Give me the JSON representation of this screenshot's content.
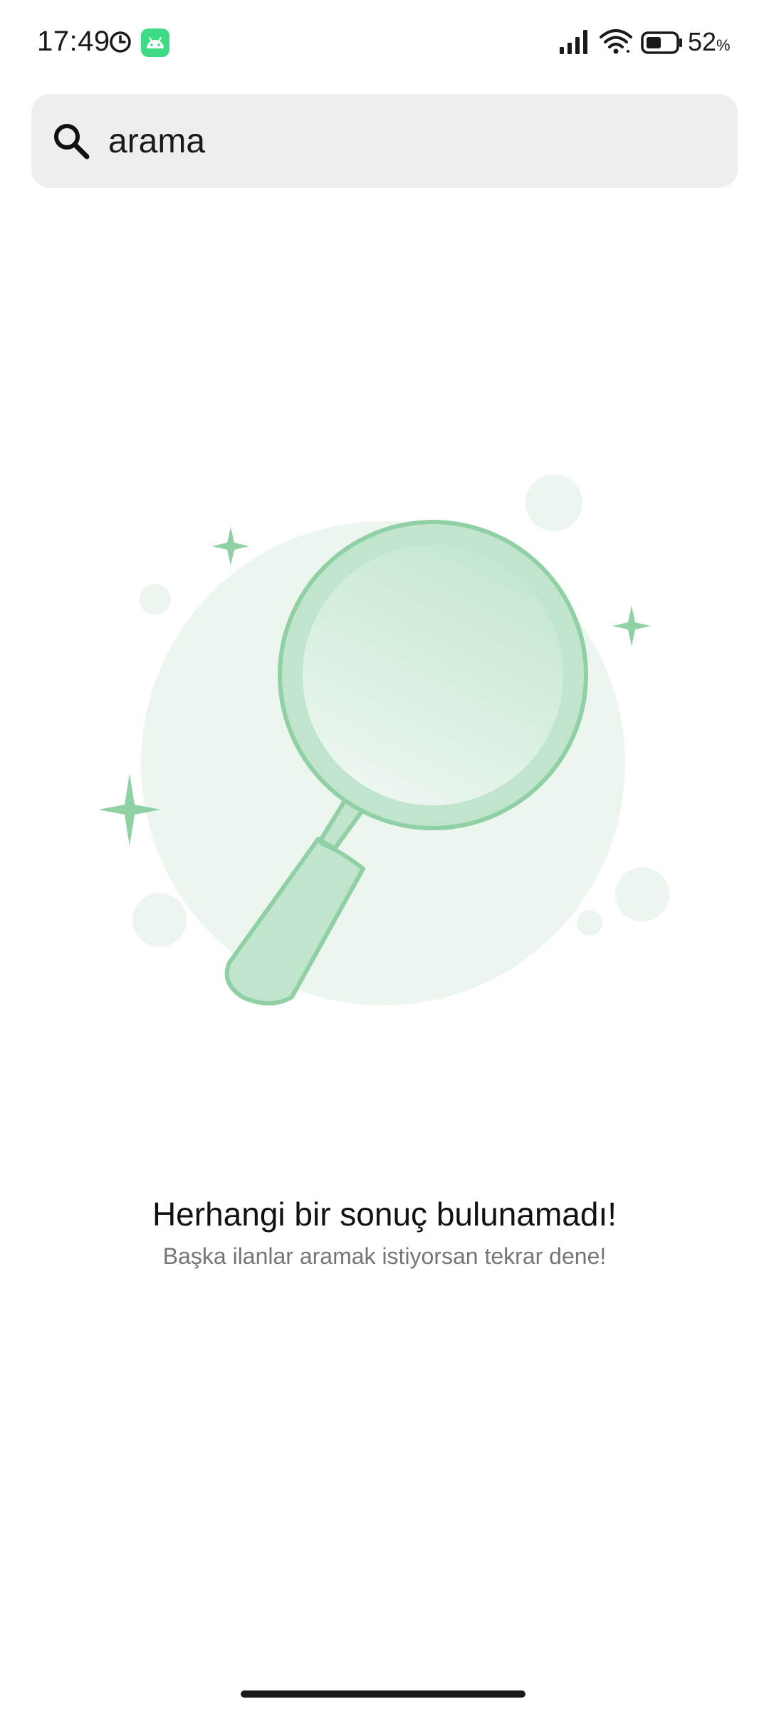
{
  "status_bar": {
    "time": "17:49",
    "battery_percent": "52",
    "battery_unit": "%",
    "battery_level": 0.52,
    "icons": [
      "alarm-clock-icon",
      "android-app-icon",
      "signal-icon",
      "wifi-icon",
      "battery-icon"
    ]
  },
  "search": {
    "value": "arama",
    "icon": "search-icon"
  },
  "empty_state": {
    "title": "Herhangi bir sonuç bulunamadı!",
    "subtitle": "Başka ilanlar aramak istiyorsan tekrar dene!",
    "illustration": "magnifying-glass-illustration"
  },
  "colors": {
    "accent_green": "#8fd0a4",
    "accent_green_light": "#c0e5cc",
    "background_circle": "#edf5ef",
    "search_bg": "#eeeeee"
  }
}
